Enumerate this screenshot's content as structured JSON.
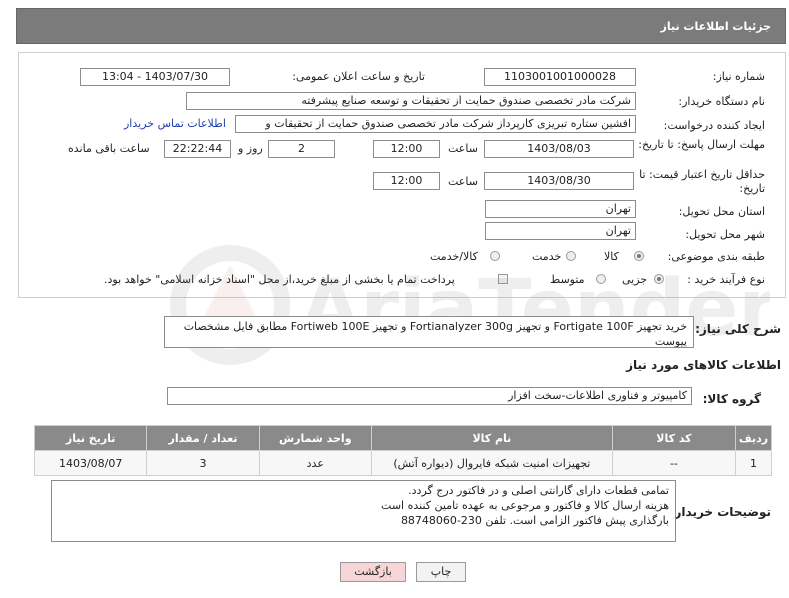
{
  "header": {
    "title": "جزئیات اطلاعات نیاز"
  },
  "form": {
    "need_number_label": "شماره نیاز:",
    "need_number": "1103001001000028",
    "announce_label": "تاریخ و ساعت اعلان عمومی:",
    "announce_value": "1403/07/30 - 13:04",
    "buyer_org_label": "نام دستگاه خریدار:",
    "buyer_org": "شرکت مادر تخصصی صندوق حمایت از تحقیقات و توسعه صنایع پیشرفته",
    "creator_label": "ایجاد کننده درخواست:",
    "creator": "افشین  ستاره تبریزی کارپرداز شرکت مادر تخصصی صندوق حمایت از تحقیقات و",
    "contact_link": "اطلاعات تماس خریدار",
    "deadline_label": "مهلت ارسال پاسخ: تا تاریخ:",
    "deadline_date": "1403/08/03",
    "time_label": "ساعت",
    "deadline_time": "12:00",
    "days_value": "2",
    "days_label": "روز و",
    "remaining_time": "22:22:44",
    "remaining_label": "ساعت باقی مانده",
    "price_validity_label": "حداقل تاریخ اعتبار قیمت: تا تاریخ:",
    "price_validity_date": "1403/08/30",
    "price_validity_time": "12:00",
    "province_label": "استان محل تحویل:",
    "province": "تهران",
    "city_label": "شهر محل تحویل:",
    "city": "تهران",
    "category_label": "طبقه بندی موضوعی:",
    "category_options": [
      "کالا",
      "خدمت",
      "کالا/خدمت"
    ],
    "purchase_type_label": "نوع فرآیند خرید :",
    "purchase_options": [
      "جزیی",
      "متوسط"
    ],
    "payment_note": "پرداخت تمام یا بخشی از مبلغ خرید،از محل \"اسناد خزانه اسلامی\" خواهد بود."
  },
  "description": {
    "label": "شرح کلی نیاز:",
    "text": "خرید تجهیز Fortigate 100F  و تجهیز Fortianalyzer 300g و تجهیز Fortiweb 100E مطابق فایل مشخصات پیوست"
  },
  "goods_section": {
    "title": "اطلاعات کالاهای مورد نیاز",
    "group_label": "گروه کالا:",
    "group_value": "کامپیوتر و فناوری اطلاعات-سخت افزار"
  },
  "table": {
    "headers": [
      "ردیف",
      "کد کالا",
      "نام کالا",
      "واحد شمارش",
      "تعداد / مقدار",
      "تاریخ نیاز"
    ],
    "rows": [
      [
        "1",
        "--",
        "تجهیزات امنیت شبکه فایروال (دیواره آتش)",
        "عدد",
        "3",
        "1403/08/07"
      ]
    ]
  },
  "buyer_notes": {
    "label": "توضیحات خریدار:",
    "lines": [
      "تمامی قطعات دارای گارانتی اصلی و در فاکتور درج گردد.",
      "هزینه ارسال کالا و فاکتور و مرجوعی به عهده تامین کننده است",
      "بارگذاری پیش فاکتور الزامی است. تلفن 230-88748060"
    ]
  },
  "buttons": {
    "print": "چاپ",
    "back": "بازگشت"
  },
  "watermark_text": "AriaTender.neT",
  "colors": {
    "header_bg": "#7b7b7b",
    "table_header": "#8a8a8a",
    "link": "#1f3fae",
    "back_btn": "#f6d6d6"
  }
}
